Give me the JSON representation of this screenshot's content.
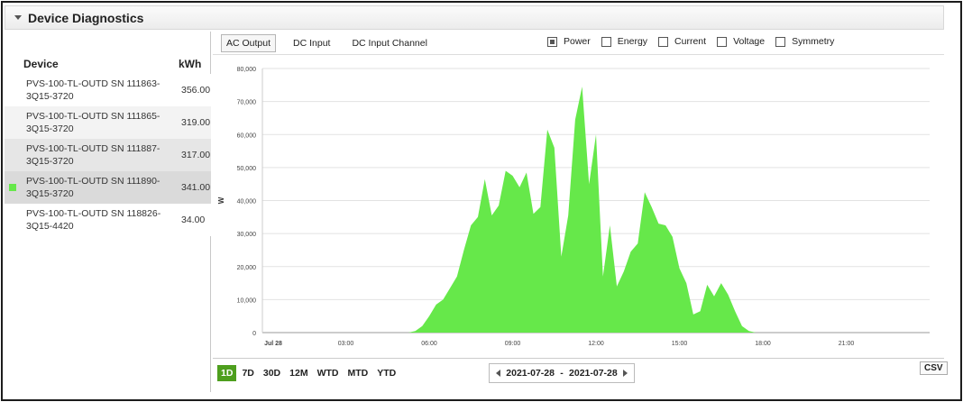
{
  "header": {
    "title": "Device Diagnostics"
  },
  "devices": {
    "col_device": "Device",
    "col_kwh": "kWh",
    "rows": [
      {
        "name": "PVS-100-TL-OUTD SN 111863-3Q15-3720",
        "kwh": "356.00",
        "bg": "#ffffff",
        "selected": false
      },
      {
        "name": "PVS-100-TL-OUTD SN 111865-3Q15-3720",
        "kwh": "319.00",
        "bg": "#f3f3f3",
        "selected": false
      },
      {
        "name": "PVS-100-TL-OUTD SN 111887-3Q15-3720",
        "kwh": "317.00",
        "bg": "#e6e6e6",
        "selected": false
      },
      {
        "name": "PVS-100-TL-OUTD SN 111890-3Q15-3720",
        "kwh": "341.00",
        "bg": "#dadada",
        "selected": true
      },
      {
        "name": "PVS-100-TL-OUTD SN 118826-3Q15-4420",
        "kwh": "34.00",
        "bg": "#ffffff",
        "selected": false
      }
    ]
  },
  "tabs": [
    {
      "label": "AC Output",
      "active": true
    },
    {
      "label": "DC Input",
      "active": false
    },
    {
      "label": "DC Input Channel",
      "active": false
    }
  ],
  "metrics": [
    {
      "label": "Power",
      "checked": true
    },
    {
      "label": "Energy",
      "checked": false
    },
    {
      "label": "Current",
      "checked": false
    },
    {
      "label": "Voltage",
      "checked": false
    },
    {
      "label": "Symmetry",
      "checked": false
    }
  ],
  "ranges": [
    {
      "label": "1D",
      "active": true
    },
    {
      "label": "7D",
      "active": false
    },
    {
      "label": "30D",
      "active": false
    },
    {
      "label": "12M",
      "active": false
    },
    {
      "label": "WTD",
      "active": false
    },
    {
      "label": "MTD",
      "active": false
    },
    {
      "label": "YTD",
      "active": false
    }
  ],
  "date_range": {
    "start": "2021-07-28",
    "sep": "-",
    "end": "2021-07-28"
  },
  "csv_label": "CSV",
  "chart_data": {
    "type": "area",
    "ylabel": "W",
    "ylim": [
      0,
      80000
    ],
    "yticks": [
      0,
      10000,
      20000,
      30000,
      40000,
      50000,
      60000,
      70000,
      80000
    ],
    "ytick_labels": [
      "0",
      "10,000",
      "20,000",
      "30,000",
      "40,000",
      "50,000",
      "60,000",
      "70,000",
      "80,000"
    ],
    "xlim_hours": [
      0,
      24
    ],
    "xticks_hours": [
      0,
      3,
      6,
      9,
      12,
      15,
      18,
      21
    ],
    "xtick_labels": [
      "Jul 28",
      "03:00",
      "06:00",
      "09:00",
      "12:00",
      "15:00",
      "18:00",
      "21:00"
    ],
    "color": "#66e84a",
    "grid": true,
    "series": [
      {
        "x_hours": [
          0,
          5.25,
          5.5,
          5.75,
          6.0,
          6.25,
          6.5,
          6.75,
          7.0,
          7.25,
          7.5,
          7.75,
          8.0,
          8.25,
          8.5,
          8.75,
          9.0,
          9.25,
          9.5,
          9.75,
          10.0,
          10.25,
          10.5,
          10.75,
          11.0,
          11.25,
          11.5,
          11.75,
          12.0,
          12.25,
          12.5,
          12.75,
          13.0,
          13.25,
          13.5,
          13.75,
          14.0,
          14.25,
          14.5,
          14.75,
          15.0,
          15.25,
          15.5,
          15.75,
          16.0,
          16.25,
          16.5,
          16.75,
          17.0,
          17.25,
          17.5,
          17.75,
          18.0,
          24
        ],
        "values": [
          0,
          0,
          500,
          2000,
          5000,
          8500,
          10000,
          13500,
          17000,
          25000,
          32500,
          35000,
          46500,
          35500,
          38500,
          49000,
          47500,
          44000,
          48500,
          36000,
          38000,
          61500,
          56000,
          23000,
          35500,
          64500,
          74500,
          45000,
          60000,
          17000,
          32500,
          14000,
          18500,
          24500,
          27000,
          42500,
          38000,
          33000,
          32500,
          29000,
          19500,
          15000,
          5500,
          6500,
          14500,
          11000,
          15000,
          11500,
          6500,
          2000,
          500,
          0,
          0,
          0
        ]
      }
    ]
  }
}
